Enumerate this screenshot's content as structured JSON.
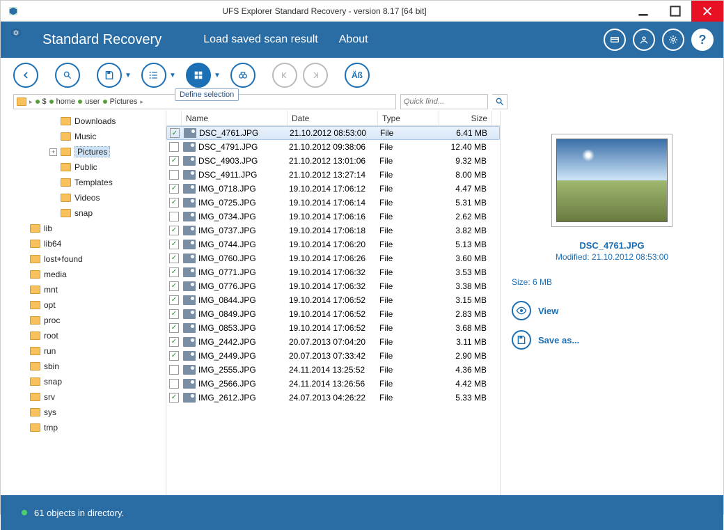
{
  "window": {
    "title": "UFS Explorer Standard Recovery - version 8.17 [64 bit]"
  },
  "header": {
    "app_name": "Standard Recovery",
    "menu": {
      "load_scan": "Load saved scan result",
      "about": "About"
    }
  },
  "toolbar": {
    "tooltip": "Define selection"
  },
  "breadcrumb": {
    "items": [
      "$",
      "home",
      "user",
      "Pictures"
    ]
  },
  "quickfind": {
    "placeholder": "Quick find..."
  },
  "tree": {
    "top": [
      {
        "label": "Downloads",
        "depth": 3,
        "toggle": ""
      },
      {
        "label": "Music",
        "depth": 3,
        "toggle": ""
      },
      {
        "label": "Pictures",
        "depth": 3,
        "toggle": "+",
        "selected": true
      },
      {
        "label": "Public",
        "depth": 3,
        "toggle": ""
      },
      {
        "label": "Templates",
        "depth": 3,
        "toggle": ""
      },
      {
        "label": "Videos",
        "depth": 3,
        "toggle": ""
      },
      {
        "label": "snap",
        "depth": 3,
        "toggle": ""
      }
    ],
    "root": [
      {
        "label": "lib",
        "depth": 1
      },
      {
        "label": "lib64",
        "depth": 1
      },
      {
        "label": "lost+found",
        "depth": 1
      },
      {
        "label": "media",
        "depth": 1
      },
      {
        "label": "mnt",
        "depth": 1
      },
      {
        "label": "opt",
        "depth": 1
      },
      {
        "label": "proc",
        "depth": 1
      },
      {
        "label": "root",
        "depth": 1
      },
      {
        "label": "run",
        "depth": 1
      },
      {
        "label": "sbin",
        "depth": 1
      },
      {
        "label": "snap",
        "depth": 1
      },
      {
        "label": "srv",
        "depth": 1
      },
      {
        "label": "sys",
        "depth": 1
      },
      {
        "label": "tmp",
        "depth": 1
      }
    ]
  },
  "filelist": {
    "headers": {
      "name": "Name",
      "date": "Date",
      "type": "Type",
      "size": "Size"
    },
    "rows": [
      {
        "checked": true,
        "name": "DSC_4761.JPG",
        "date": "21.10.2012 08:53:00",
        "type": "File",
        "size": "6.41 MB",
        "selected": true
      },
      {
        "checked": false,
        "name": "DSC_4791.JPG",
        "date": "21.10.2012 09:38:06",
        "type": "File",
        "size": "12.40 MB"
      },
      {
        "checked": true,
        "name": "DSC_4903.JPG",
        "date": "21.10.2012 13:01:06",
        "type": "File",
        "size": "9.32 MB"
      },
      {
        "checked": false,
        "name": "DSC_4911.JPG",
        "date": "21.10.2012 13:27:14",
        "type": "File",
        "size": "8.00 MB"
      },
      {
        "checked": true,
        "name": "IMG_0718.JPG",
        "date": "19.10.2014 17:06:12",
        "type": "File",
        "size": "4.47 MB"
      },
      {
        "checked": true,
        "name": "IMG_0725.JPG",
        "date": "19.10.2014 17:06:14",
        "type": "File",
        "size": "5.31 MB"
      },
      {
        "checked": false,
        "name": "IMG_0734.JPG",
        "date": "19.10.2014 17:06:16",
        "type": "File",
        "size": "2.62 MB"
      },
      {
        "checked": true,
        "name": "IMG_0737.JPG",
        "date": "19.10.2014 17:06:18",
        "type": "File",
        "size": "3.82 MB"
      },
      {
        "checked": true,
        "name": "IMG_0744.JPG",
        "date": "19.10.2014 17:06:20",
        "type": "File",
        "size": "5.13 MB"
      },
      {
        "checked": true,
        "name": "IMG_0760.JPG",
        "date": "19.10.2014 17:06:26",
        "type": "File",
        "size": "3.60 MB"
      },
      {
        "checked": true,
        "name": "IMG_0771.JPG",
        "date": "19.10.2014 17:06:32",
        "type": "File",
        "size": "3.53 MB"
      },
      {
        "checked": true,
        "name": "IMG_0776.JPG",
        "date": "19.10.2014 17:06:32",
        "type": "File",
        "size": "3.38 MB"
      },
      {
        "checked": true,
        "name": "IMG_0844.JPG",
        "date": "19.10.2014 17:06:52",
        "type": "File",
        "size": "3.15 MB"
      },
      {
        "checked": true,
        "name": "IMG_0849.JPG",
        "date": "19.10.2014 17:06:52",
        "type": "File",
        "size": "2.83 MB"
      },
      {
        "checked": true,
        "name": "IMG_0853.JPG",
        "date": "19.10.2014 17:06:52",
        "type": "File",
        "size": "3.68 MB"
      },
      {
        "checked": true,
        "name": "IMG_2442.JPG",
        "date": "20.07.2013 07:04:20",
        "type": "File",
        "size": "3.11 MB"
      },
      {
        "checked": true,
        "name": "IMG_2449.JPG",
        "date": "20.07.2013 07:33:42",
        "type": "File",
        "size": "2.90 MB"
      },
      {
        "checked": false,
        "name": "IMG_2555.JPG",
        "date": "24.11.2014 13:25:52",
        "type": "File",
        "size": "4.36 MB"
      },
      {
        "checked": false,
        "name": "IMG_2566.JPG",
        "date": "24.11.2014 13:26:56",
        "type": "File",
        "size": "4.42 MB"
      },
      {
        "checked": true,
        "name": "IMG_2612.JPG",
        "date": "24.07.2013 04:26:22",
        "type": "File",
        "size": "5.33 MB"
      }
    ]
  },
  "preview": {
    "filename": "DSC_4761.JPG",
    "modified": "Modified: 21.10.2012 08:53:00",
    "size": "Size: 6 MB",
    "view": "View",
    "saveas": "Save as..."
  },
  "status": {
    "text": "61 objects in directory."
  }
}
